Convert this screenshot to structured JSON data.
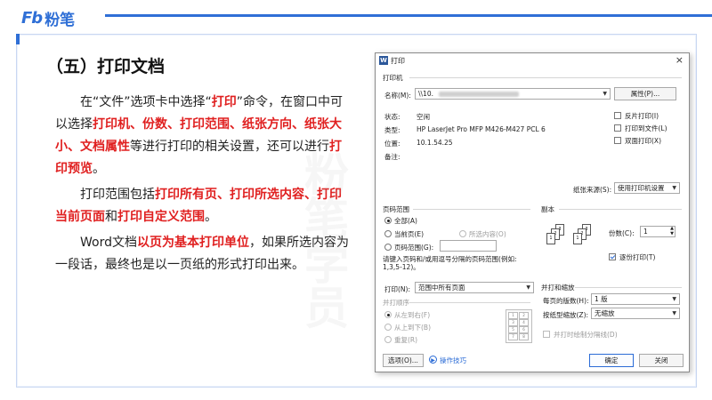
{
  "brand": {
    "latin": "Fb",
    "cn": "粉笔"
  },
  "slide": {
    "section_title": "（五）打印文档",
    "watermark": "粉笔学员",
    "p1": [
      {
        "t": "在“文件”选项卡中选择“",
        "red": false
      },
      {
        "t": "打印",
        "red": true
      },
      {
        "t": "”命令，在窗口中可以选择",
        "red": false
      },
      {
        "t": "打印机、份数、打印范围、纸张方向、纸张大小、文档属性",
        "red": true
      },
      {
        "t": "等进行打印的相关设置，还可以进行",
        "red": false
      },
      {
        "t": "打印预览",
        "red": true
      },
      {
        "t": "。",
        "red": false
      }
    ],
    "p2": [
      {
        "t": "打印范围包括",
        "red": false
      },
      {
        "t": "打印所有页、打印所选内容、打印当前页面",
        "red": true
      },
      {
        "t": "和",
        "red": false
      },
      {
        "t": "打印自定义范围",
        "red": true
      },
      {
        "t": "。",
        "red": false
      }
    ],
    "p3": [
      {
        "t": "Word文档",
        "red": false
      },
      {
        "t": "以页为基本打印单位",
        "red": true
      },
      {
        "t": "，如果所选内容为一段话，最终也是以一页纸的形式打印出来。",
        "red": false
      }
    ]
  },
  "dialog": {
    "app_icon": "W",
    "title": "打印",
    "close": "×",
    "printer_group": "打印机",
    "name_label": "名称(M):",
    "name_value": "\\\\10.",
    "properties_btn": "属性(P)...",
    "status_label": "状态:",
    "status_value": "空闲",
    "type_label": "类型:",
    "type_value": "HP LaserJet Pro MFP M426-M427 PCL 6",
    "location_label": "位置:",
    "location_value": "10.1.54.25",
    "comment_label": "备注:",
    "reverse_print": "反片打印(I)",
    "print_to_file": "打印到文件(L)",
    "duplex": "双面打印(X)",
    "paper_source_label": "纸张来源(S):",
    "paper_source_value": "使用打印机设置",
    "range_group": "页码范围",
    "range_all": "全部(A)",
    "range_current": "当前页(E)",
    "range_selection": "所选内容(O)",
    "range_pages": "页码范围(G):",
    "range_hint": "请键入页码和/或用逗号分隔的页码范围(例如: 1,3,5-12)。",
    "copies_group": "副本",
    "copies_label": "份数(C):",
    "copies_value": "1",
    "collate": "逐份打印(T)",
    "print_label": "打印(N):",
    "print_value": "范围中所有页面",
    "merge_order_group": "并打顺序",
    "order_lr": "从左到右(F)",
    "order_tb": "从上到下(B)",
    "order_repeat": "重复(R)",
    "zoom_group": "并打和缩放",
    "pages_per_sheet_label": "每页的版数(H):",
    "pages_per_sheet_value": "1 版",
    "scale_label": "按纸型缩放(Z):",
    "scale_value": "无缩放",
    "merge_lines": "并打时绘制分隔线(D)",
    "options_btn": "选项(O)...",
    "tips_link": "操作技巧",
    "ok_btn": "确定",
    "cancel_btn": "关闭"
  },
  "colors": {
    "brand": "#2f6fd6",
    "highlight": "#e02020"
  }
}
